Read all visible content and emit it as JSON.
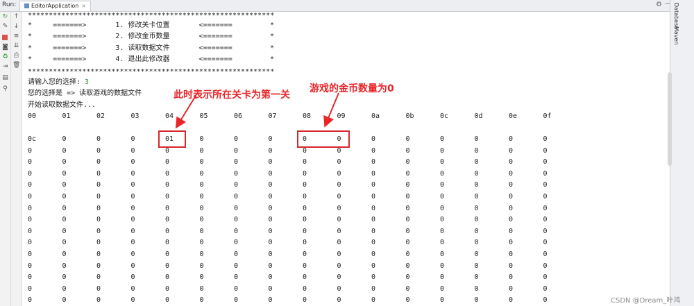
{
  "toolbar": {
    "run_label": "Run:",
    "tab_label": "EditorApplication",
    "tab_close": "×",
    "gear_glyph": "⚙",
    "minimize_glyph": "—"
  },
  "right_sidebar": {
    "database_label": "Database",
    "maven_label": "Maven"
  },
  "console": {
    "menu_border": "***********************************************************",
    "menu_items": [
      "*     =======>       1. 修改关卡位置       <=======         *",
      "*     =======>       2. 修改金币数量       <=======         *",
      "*     =======>       3. 读取数据文件       <=======         *",
      "*     =======>       4. 退出此修改器       <=======         *"
    ],
    "prompt_text": "请输入您的选择: ",
    "prompt_input": "3",
    "choice_line": "您的选择是 => 读取游戏的数据文件",
    "reading_line": "开始读取数据文件...",
    "hex_header": [
      "00",
      "01",
      "02",
      "03",
      "04",
      "05",
      "06",
      "07",
      "08",
      "09",
      "0a",
      "0b",
      "0c",
      "0d",
      "0e",
      "0f"
    ],
    "rows": [
      [
        "0c",
        "0",
        "0",
        "0",
        "01",
        "0",
        "0",
        "0",
        "0",
        "0",
        "0",
        "0",
        "0",
        "0",
        "0",
        "0"
      ],
      [
        "0",
        "0",
        "0",
        "0",
        "0",
        "0",
        "0",
        "0",
        "0",
        "0",
        "0",
        "0",
        "0",
        "0",
        "0",
        "0"
      ],
      [
        "0",
        "0",
        "0",
        "0",
        "0",
        "0",
        "0",
        "0",
        "0",
        "0",
        "0",
        "0",
        "0",
        "0",
        "0",
        "0"
      ],
      [
        "0",
        "0",
        "0",
        "0",
        "0",
        "0",
        "0",
        "0",
        "0",
        "0",
        "0",
        "0",
        "0",
        "0",
        "0",
        "0"
      ],
      [
        "0",
        "0",
        "0",
        "0",
        "0",
        "0",
        "0",
        "0",
        "0",
        "0",
        "0",
        "0",
        "0",
        "0",
        "0",
        "0"
      ],
      [
        "0",
        "0",
        "0",
        "0",
        "0",
        "0",
        "0",
        "0",
        "0",
        "0",
        "0",
        "0",
        "0",
        "0",
        "0",
        "0"
      ],
      [
        "0",
        "0",
        "0",
        "0",
        "0",
        "0",
        "0",
        "0",
        "0",
        "0",
        "0",
        "0",
        "0",
        "0",
        "0",
        "0"
      ],
      [
        "0",
        "0",
        "0",
        "0",
        "0",
        "0",
        "0",
        "0",
        "0",
        "0",
        "0",
        "0",
        "0",
        "0",
        "0",
        "0"
      ],
      [
        "0",
        "0",
        "0",
        "0",
        "0",
        "0",
        "0",
        "0",
        "0",
        "0",
        "0",
        "0",
        "0",
        "0",
        "0",
        "0"
      ],
      [
        "0",
        "0",
        "0",
        "0",
        "0",
        "0",
        "0",
        "0",
        "0",
        "0",
        "0",
        "0",
        "0",
        "0",
        "0",
        "0"
      ],
      [
        "0",
        "0",
        "0",
        "0",
        "0",
        "0",
        "0",
        "0",
        "0",
        "0",
        "0",
        "0",
        "0",
        "0",
        "0",
        "0"
      ],
      [
        "0",
        "0",
        "0",
        "0",
        "0",
        "0",
        "0",
        "0",
        "0",
        "0",
        "0",
        "0",
        "0",
        "0",
        "0",
        "0"
      ],
      [
        "0",
        "0",
        "0",
        "0",
        "0",
        "0",
        "0",
        "0",
        "0",
        "0",
        "0",
        "0",
        "0",
        "0",
        "0",
        "0"
      ],
      [
        "0",
        "0",
        "0",
        "0",
        "0",
        "0",
        "0",
        "0",
        "0",
        "0",
        "0",
        "0",
        "0",
        "0",
        "0",
        "0"
      ],
      [
        "0",
        "0",
        "0",
        "0",
        "0",
        "0",
        "0",
        "0",
        "0",
        "0",
        "0",
        "0",
        "0",
        "0",
        "0",
        "0"
      ]
    ]
  },
  "annotations": {
    "level_note": "此时表示所在关卡为第一关",
    "coin_note": "游戏的金币数量为0",
    "color": "#e8262a"
  },
  "watermark": "CSDN @Dream_叶鸿"
}
